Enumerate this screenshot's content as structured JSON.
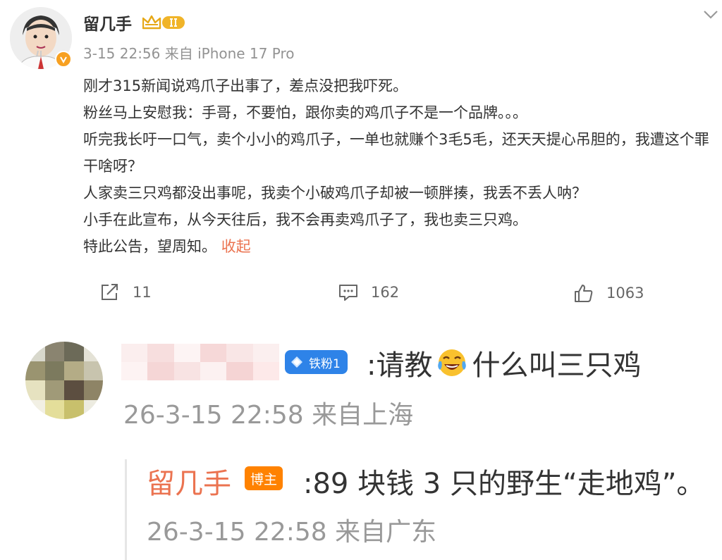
{
  "post": {
    "author": "留几手",
    "meta": "3-15 22:56 来自 iPhone 17 Pro",
    "lines": [
      "刚才315新闻说鸡爪子出事了，差点没把我吓死。",
      "粉丝马上安慰我：手哥，不要怕，跟你卖的鸡爪子不是一个品牌。。。",
      "听完我长吁一口气，卖个小小的鸡爪子，一单也就赚个3毛5毛，还天天提心吊胆的，我遭这个罪干啥呀？",
      "人家卖三只鸡都没出事呢，我卖个小破鸡爪子却被一顿胖揍，我丢不丢人呐？",
      "小手在此宣布，从今天往后，我不会再卖鸡爪子了，我也卖三只鸡。"
    ],
    "last_line": "特此公告，望周知。",
    "collapse_label": "收起"
  },
  "actions": {
    "repost_count": "11",
    "comment_count": "162",
    "like_count": "1063"
  },
  "comment": {
    "fan_badge": "铁粉1",
    "text_before": ":请教",
    "text_after": "什么叫三只鸡",
    "meta": "26-3-15 22:58 来自上海"
  },
  "reply": {
    "author": "留几手",
    "badge": "博主",
    "text": ":89 块钱 3 只的野生“走地鸡”。",
    "meta": "26-3-15 22:58 来自广东"
  },
  "colors": {
    "accent": "#eb7350",
    "fan_badge": "#2e83e8",
    "blogger_badge": "#ff8200",
    "verified_badge": "#f7a021"
  },
  "icons": [
    "crown-badge-icon",
    "chevron-down-icon",
    "repost-icon",
    "comment-icon",
    "like-icon",
    "laugh-cry-emoji-icon",
    "diamond-icon",
    "verified-icon"
  ]
}
